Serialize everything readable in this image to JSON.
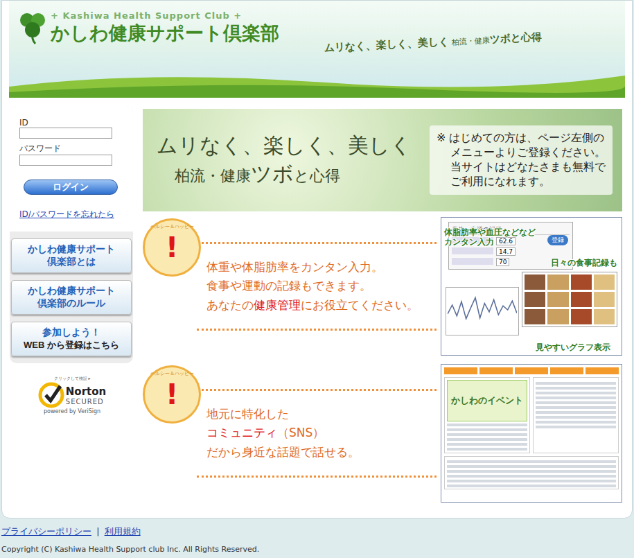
{
  "header": {
    "tagline_en": "+ Kashiwa Health Support Club +",
    "logo": "かしわ健康サポート倶楽部",
    "slogan": [
      {
        "text": "ムリなく、楽しく、美しく",
        "size": "m"
      },
      {
        "text": "柏流・健康",
        "size": "s"
      },
      {
        "text": "ツボと心得",
        "size": "m"
      }
    ]
  },
  "login": {
    "id_label": "ID",
    "password_label": "パスワード",
    "button": "ログイン",
    "forgot": "ID/パスワードを忘れたら"
  },
  "menu": [
    {
      "lines": [
        "かしわ健康サポート",
        "倶楽部とは"
      ],
      "kind": "info"
    },
    {
      "lines": [
        "かしわ健康サポート",
        "倶楽部のルール"
      ],
      "kind": "info"
    },
    {
      "lines": [
        "参加しよう！",
        "WEB から登録はこちら"
      ],
      "kind": "join"
    }
  ],
  "norton": {
    "hint": "クリックして検証 ▸",
    "brand": "Norton",
    "status": "SECURED",
    "powered": "powered by VeriSign"
  },
  "banner": {
    "title": "ムリなく、楽しく、美しく",
    "subtitle": [
      "柏流・健康",
      "ツボ",
      "と心得"
    ],
    "note": [
      "※ はじめての方は、ページ左側の",
      "メニューよりご登録ください。",
      "当サイトはどなたさまも無料で",
      "ご利用になれます。"
    ]
  },
  "features": [
    {
      "badge_ring": "ヘルシー＆ハッピー",
      "badge_mark": "!",
      "lines": [
        [
          {
            "text": "体重や体脂肪率をカンタン入力。",
            "em": false
          }
        ],
        [
          {
            "text": "食事や運動の記録もできます。",
            "em": false
          }
        ],
        [
          {
            "text": "あなたの",
            "em": false
          },
          {
            "text": "健康管理",
            "em": true
          },
          {
            "text": "にお役立てください。",
            "em": false
          }
        ]
      ],
      "kind": "records",
      "callouts": [
        "体脂肪率や血圧などなど",
        "カンタン入力",
        "日々の食事記録も",
        "見やすいグラフ表示"
      ],
      "form_title": "身体・生活の記録",
      "form_button": "登録",
      "form_values": [
        "62.6",
        "14.7",
        "70"
      ],
      "graph": [
        40,
        62,
        35,
        70,
        28,
        55,
        80,
        30,
        66,
        45,
        75,
        38,
        60,
        50,
        72,
        42
      ]
    },
    {
      "badge_ring": "ヘルシー＆ハッピー",
      "badge_mark": "!",
      "lines": [
        [
          {
            "text": "地元に特化した",
            "em": false
          }
        ],
        [
          {
            "text": "コミュニティ",
            "em": true
          },
          {
            "text": "（SNS）",
            "em": false
          }
        ],
        [
          {
            "text": "だから身近な話題で話せる。",
            "em": false
          }
        ]
      ],
      "kind": "community",
      "event_title": "かしわのイベント"
    }
  ],
  "footer": {
    "links": [
      "プライバシーポリシー",
      "利用規約"
    ],
    "separator": "|",
    "copyright": "Copyright (C) Kashiwa Health Support club Inc. All Rights Reserved."
  }
}
